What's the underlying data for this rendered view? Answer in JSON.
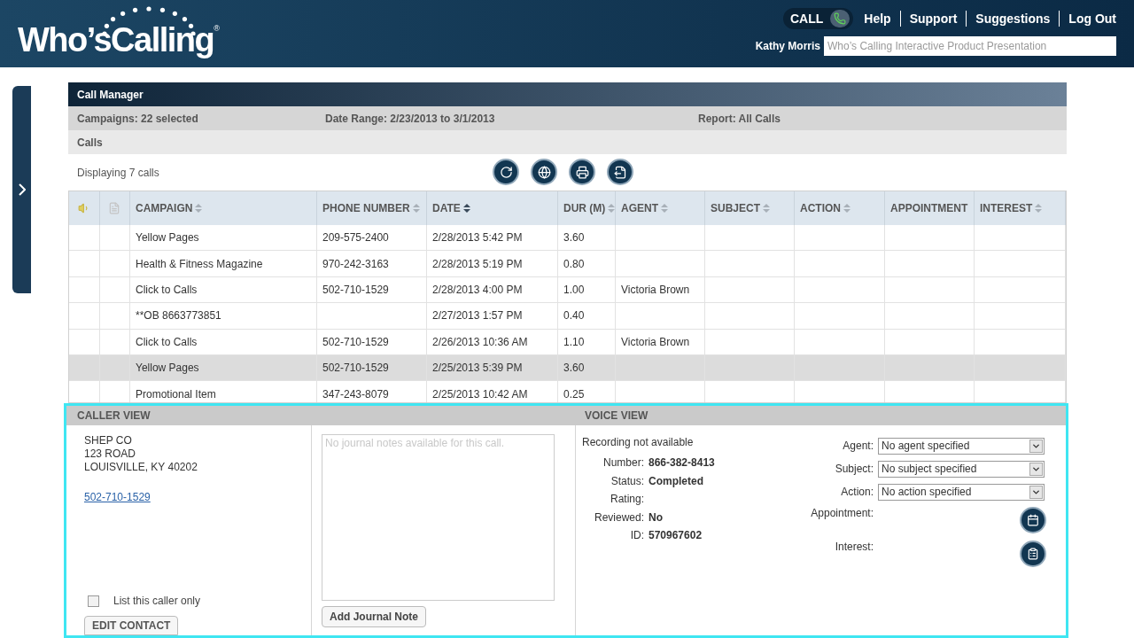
{
  "header": {
    "logo": "Who’sCalling",
    "logo_mark": "®",
    "call_button": "CALL",
    "links": [
      "Help",
      "Support",
      "Suggestions",
      "Log Out"
    ],
    "user": "Kathy Morris",
    "search": {
      "placeholder": "Who’s Calling Interactive Product Presentation"
    }
  },
  "call_manager": {
    "title": "Call Manager",
    "campaigns": "Campaigns: 22 selected",
    "date_range": "Date Range: 2/23/2013 to 3/1/2013",
    "report": "Report: All Calls",
    "section": "Calls",
    "count": "Displaying 7 calls"
  },
  "table": {
    "columns": [
      {
        "label": "CAMPAIGN",
        "sortable": true,
        "sorted": false
      },
      {
        "label": "PHONE NUMBER",
        "sortable": true,
        "sorted": false
      },
      {
        "label": "DATE",
        "sortable": true,
        "sorted": true
      },
      {
        "label": "DUR (M)",
        "sortable": true,
        "sorted": false
      },
      {
        "label": "AGENT",
        "sortable": true,
        "sorted": false
      },
      {
        "label": "SUBJECT",
        "sortable": true,
        "sorted": false
      },
      {
        "label": "ACTION",
        "sortable": true,
        "sorted": false
      },
      {
        "label": "APPOINTMENT",
        "sortable": false,
        "sorted": false
      },
      {
        "label": "INTEREST",
        "sortable": true,
        "sorted": false
      }
    ],
    "rows": [
      {
        "selected": false,
        "cells": [
          "Yellow Pages",
          "209-575-2400",
          "2/28/2013 5:42 PM",
          "3.60",
          "",
          "",
          "",
          "",
          ""
        ]
      },
      {
        "selected": false,
        "cells": [
          "Health & Fitness Magazine",
          "970-242-3163",
          "2/28/2013 5:19 PM",
          "0.80",
          "",
          "",
          "",
          "",
          ""
        ]
      },
      {
        "selected": false,
        "cells": [
          "Click to Calls",
          "502-710-1529",
          "2/28/2013 4:00 PM",
          "1.00",
          "Victoria Brown",
          "",
          "",
          "",
          ""
        ]
      },
      {
        "selected": false,
        "cells": [
          "**OB 8663773851",
          "",
          "2/27/2013 1:57 PM",
          "0.40",
          "",
          "",
          "",
          "",
          ""
        ]
      },
      {
        "selected": false,
        "cells": [
          "Click to Calls",
          "502-710-1529",
          "2/26/2013 10:36 AM",
          "1.10",
          "Victoria Brown",
          "",
          "",
          "",
          ""
        ]
      },
      {
        "selected": true,
        "cells": [
          "Yellow Pages",
          "502-710-1529",
          "2/25/2013 5:39 PM",
          "3.60",
          "",
          "",
          "",
          "",
          ""
        ]
      },
      {
        "selected": false,
        "cells": [
          "Promotional Item",
          "347-243-8079",
          "2/25/2013 10:42 AM",
          "0.25",
          "",
          "",
          "",
          "",
          ""
        ]
      }
    ]
  },
  "caller_view": {
    "title": "CALLER VIEW",
    "address": [
      "SHEP CO",
      "123 ROAD",
      "LOUISVILLE, KY 40202"
    ],
    "phone": "502-710-1529",
    "list_only": {
      "label": "List this caller only",
      "checked": false
    },
    "edit_button": "EDIT CONTACT",
    "journal": {
      "placeholder": "No journal notes available for this call."
    },
    "add_note_button": "Add Journal Note"
  },
  "voice_view": {
    "title": "VOICE VIEW",
    "recording": "Recording not available",
    "details": [
      {
        "label": "Number:",
        "value": "866-382-8413"
      },
      {
        "label": "Status:",
        "value": "Completed"
      },
      {
        "label": "Rating:"
      },
      {
        "label": "Reviewed:",
        "value": "No"
      },
      {
        "label": "ID:",
        "value": "570967602"
      }
    ],
    "selects": [
      {
        "label": "Agent:",
        "value": "No agent specified"
      },
      {
        "label": "Subject:",
        "value": "No subject specified"
      },
      {
        "label": "Action:",
        "value": "No action specified"
      }
    ],
    "appointment": "Appointment:",
    "interest": "Interest:"
  }
}
